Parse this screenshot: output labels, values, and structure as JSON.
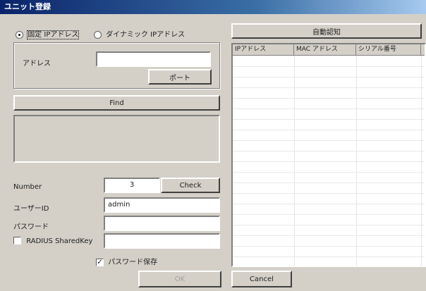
{
  "window": {
    "title": "ユニット登録"
  },
  "ip_mode": {
    "fixed_label": "固定 IPアドレス",
    "dynamic_label": "ダイナミック IPアドレス",
    "selected": "fixed"
  },
  "address": {
    "label": "アドレス",
    "value": ""
  },
  "port_button": {
    "label": "ポート"
  },
  "find_button": {
    "label": "Find"
  },
  "auto_detect_button": {
    "label": "自動認知"
  },
  "table": {
    "columns": [
      "IPアドレス",
      "MAC アドレス",
      "シリアル番号",
      ""
    ],
    "rows": []
  },
  "number": {
    "label": "Number",
    "value": "3"
  },
  "check_button": {
    "label": "Check"
  },
  "user_id": {
    "label": "ユーザーID",
    "value": "admin"
  },
  "password": {
    "label": "パスワード",
    "value": ""
  },
  "radius": {
    "label": "RADIUS SharedKey",
    "checked": false,
    "value": ""
  },
  "save_password": {
    "label": "パスワード保存",
    "checked": true
  },
  "ok_button": {
    "label": "OK"
  },
  "cancel_button": {
    "label": "Cancel"
  }
}
